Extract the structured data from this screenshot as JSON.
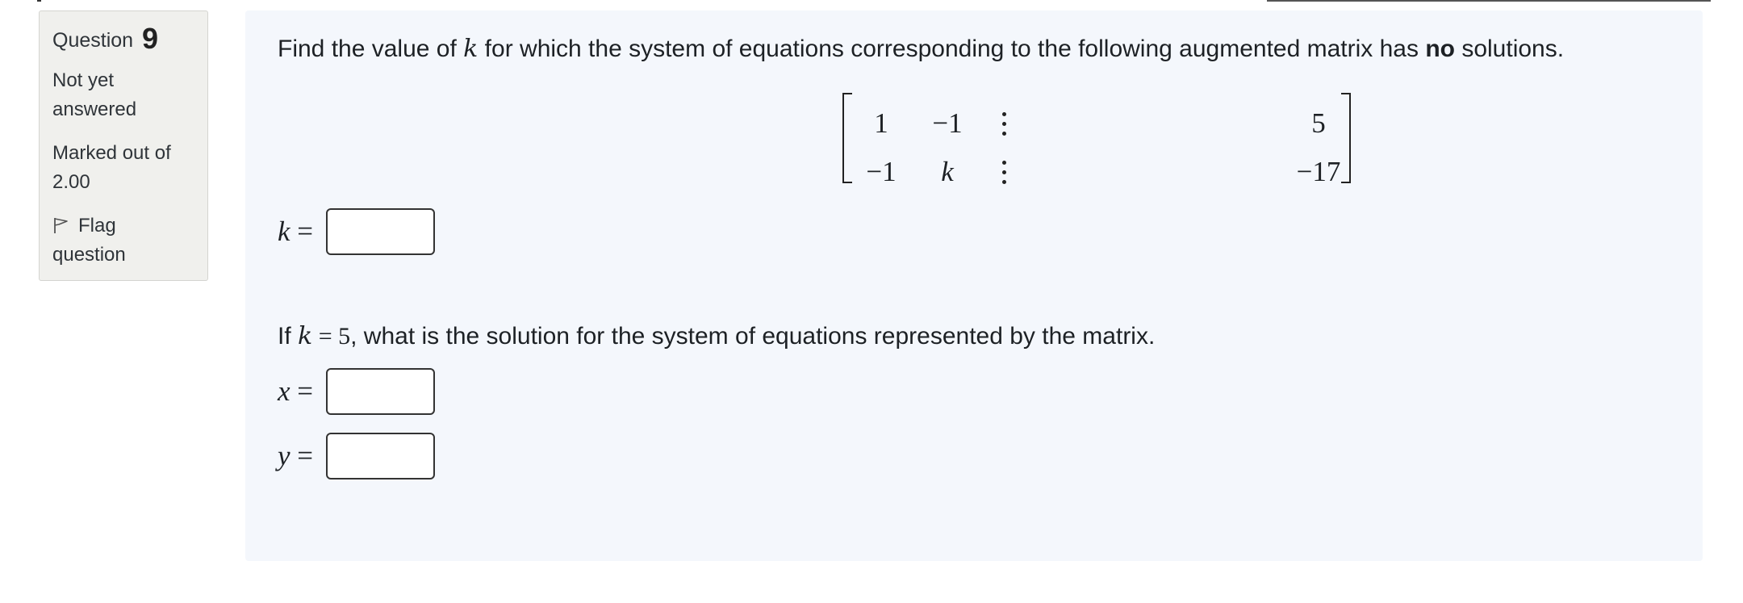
{
  "question": {
    "label": "Question",
    "number": "9",
    "state": "Not yet answered",
    "grade": "Marked out of 2.00",
    "flag_label": "Flag question"
  },
  "prompt1": {
    "before_var": "Find the value of ",
    "var": "k",
    "middle": " for which the system of equations corresponding to the following augmented matrix has ",
    "emphasis": "no",
    "after": " solutions."
  },
  "matrix": {
    "row1": {
      "a": "1",
      "b": "−1",
      "c": "5"
    },
    "row2": {
      "a": "−1",
      "b": "k",
      "c": "−17"
    }
  },
  "answer_k": {
    "var": "k",
    "eq": " =",
    "value": ""
  },
  "prompt2": {
    "before": "If ",
    "var": "k",
    "eq": " = 5",
    "after": ", what is the solution for the system of equations represented by the matrix."
  },
  "answer_x": {
    "var": "x",
    "eq": " =",
    "value": ""
  },
  "answer_y": {
    "var": "y",
    "eq": " =",
    "value": ""
  }
}
